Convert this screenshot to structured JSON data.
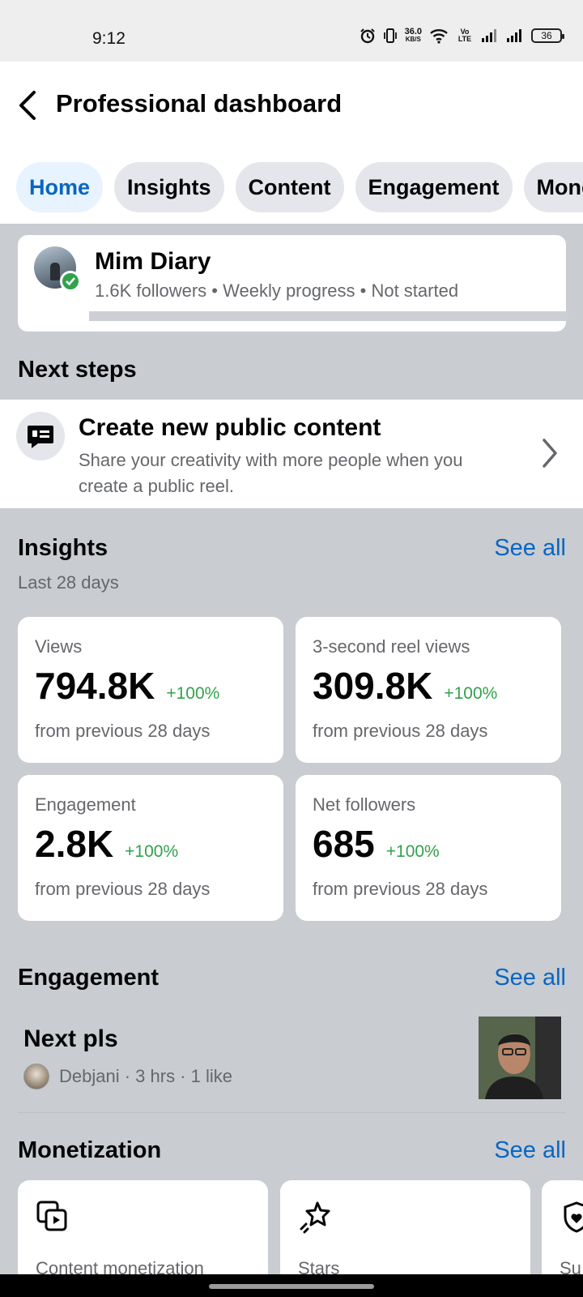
{
  "status_bar": {
    "time": "9:12",
    "net_speed_value": "36.0",
    "net_speed_unit": "KB/S",
    "volte": "Vo LTE",
    "battery": "36"
  },
  "header": {
    "title": "Professional dashboard",
    "tabs": [
      {
        "label": "Home",
        "active": true
      },
      {
        "label": "Insights",
        "active": false
      },
      {
        "label": "Content",
        "active": false
      },
      {
        "label": "Engagement",
        "active": false
      },
      {
        "label": "Mone",
        "active": false
      }
    ]
  },
  "profile": {
    "name": "Mim Diary",
    "meta": "1.6K followers • Weekly progress • Not started",
    "progress_fraction": 0
  },
  "next_steps": {
    "title": "Next steps",
    "item": {
      "title": "Create new public content",
      "description": "Share your creativity with more people when you create a public reel."
    }
  },
  "insights": {
    "title": "Insights",
    "see_all": "See all",
    "period": "Last 28 days",
    "metrics": [
      {
        "label": "Views",
        "value": "794.8K",
        "change": "+100%",
        "footnote": "from previous 28 days"
      },
      {
        "label": "3-second reel views",
        "value": "309.8K",
        "change": "+100%",
        "footnote": "from previous 28 days"
      },
      {
        "label": "Engagement",
        "value": "2.8K",
        "change": "+100%",
        "footnote": "from previous 28 days"
      },
      {
        "label": "Net followers",
        "value": "685",
        "change": "+100%",
        "footnote": "from previous 28 days"
      }
    ]
  },
  "engagement": {
    "title": "Engagement",
    "see_all": "See all",
    "post": {
      "title": "Next pls",
      "meta": "Debjani · 3 hrs · 1 like"
    }
  },
  "monetization": {
    "title": "Monetization",
    "see_all": "See all",
    "cards": [
      {
        "label": "Content monetization",
        "icon": "content-monetization-icon"
      },
      {
        "label": "Stars",
        "icon": "stars-icon"
      },
      {
        "label": "Su",
        "icon": "subscriptions-icon"
      }
    ]
  },
  "colors": {
    "accent": "#0866c2",
    "positive": "#31a24c",
    "background": "#c9ccd1"
  }
}
